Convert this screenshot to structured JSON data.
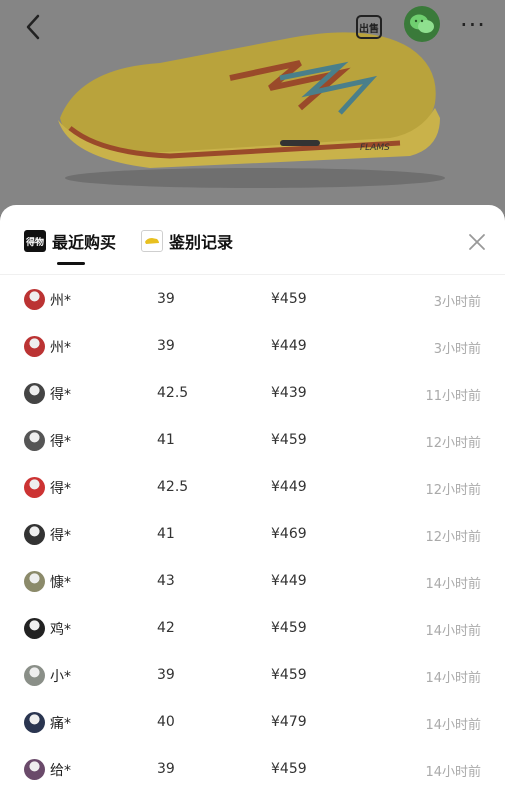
{
  "product_image": {
    "alt_icon": "sneaker-image",
    "brand_mark": "FLAMS"
  },
  "topbar": {
    "sell_label": "出售",
    "back_icon": "chevron-left-icon",
    "wechat_icon": "wechat-icon",
    "more_label": "···"
  },
  "tabs": [
    {
      "label": "最近购买",
      "badge": "得物",
      "active": true
    },
    {
      "label": "鉴别记录",
      "icon": "shoe-thumbnail-icon",
      "active": false
    }
  ],
  "close_icon": "close-icon",
  "purchases": [
    {
      "name": "州*",
      "size": "39",
      "price": "¥459",
      "time": "3小时前",
      "avatar_color": "#b33"
    },
    {
      "name": "州*",
      "size": "39",
      "price": "¥449",
      "time": "3小时前",
      "avatar_color": "#b33"
    },
    {
      "name": "得*",
      "size": "42.5",
      "price": "¥439",
      "time": "11小时前",
      "avatar_color": "#444"
    },
    {
      "name": "得*",
      "size": "41",
      "price": "¥459",
      "time": "12小时前",
      "avatar_color": "#555"
    },
    {
      "name": "得*",
      "size": "42.5",
      "price": "¥449",
      "time": "12小时前",
      "avatar_color": "#c33"
    },
    {
      "name": "得*",
      "size": "41",
      "price": "¥469",
      "time": "12小时前",
      "avatar_color": "#333"
    },
    {
      "name": "慷*",
      "size": "43",
      "price": "¥449",
      "time": "14小时前",
      "avatar_color": "#8b8a6a"
    },
    {
      "name": "鸡*",
      "size": "42",
      "price": "¥459",
      "time": "14小时前",
      "avatar_color": "#222"
    },
    {
      "name": "小*",
      "size": "39",
      "price": "¥459",
      "time": "14小时前",
      "avatar_color": "#8a8f88"
    },
    {
      "name": "痛*",
      "size": "40",
      "price": "¥479",
      "time": "14小时前",
      "avatar_color": "#2a3550"
    },
    {
      "name": "给*",
      "size": "39",
      "price": "¥459",
      "time": "14小时前",
      "avatar_color": "#6a4a6a"
    }
  ]
}
